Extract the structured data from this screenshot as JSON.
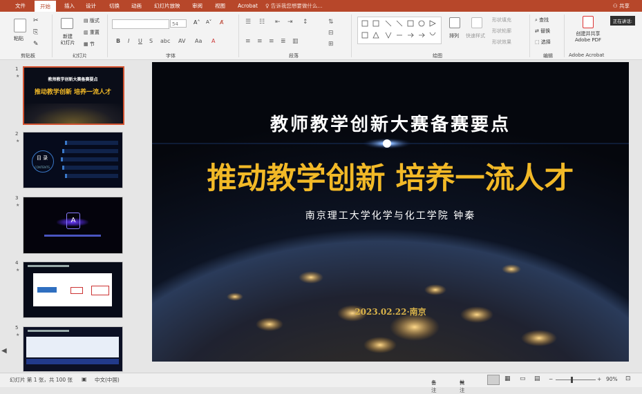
{
  "menu": {
    "tabs": [
      "文件",
      "开始",
      "插入",
      "设计",
      "切换",
      "动画",
      "幻灯片放映",
      "审阅",
      "视图",
      "Acrobat"
    ],
    "active_tab": "开始",
    "tell_me": "告诉我您想要做什么...",
    "share": "共享"
  },
  "ribbon": {
    "paste": "粘贴",
    "new_slide": "新建\n幻灯片",
    "layout": "版式",
    "reset": "重置",
    "section": "节",
    "font_size": "54",
    "arrange": "排列",
    "quick_styles": "快速样式",
    "shape_fill": "形状填充",
    "shape_outline": "形状轮廓",
    "shape_effect": "形状效果",
    "find": "查找",
    "replace": "替换",
    "select": "选择",
    "acrobat_button": "创建并共享\nAdobe PDF",
    "presenting": "正在讲话:",
    "groups": {
      "clipboard": "剪贴板",
      "slides": "幻灯片",
      "font": "字体",
      "paragraph": "段落",
      "drawing": "绘图",
      "editing": "编辑",
      "acrobat": "Adobe Acrobat"
    }
  },
  "thumbnails": [
    {
      "num": "1",
      "title": "推动教学创新 培养一流人才",
      "subtitle": "教师教学创新大赛备赛要点"
    },
    {
      "num": "2",
      "title": "目 录",
      "subtitle": "CONTENTS"
    },
    {
      "num": "3",
      "title": "A",
      "subtitle": ""
    },
    {
      "num": "4",
      "title": "",
      "subtitle": ""
    },
    {
      "num": "5",
      "title": "",
      "subtitle": ""
    }
  ],
  "slide": {
    "supertitle": "教师教学创新大赛备赛要点",
    "title": "推动教学创新 培养一流人才",
    "author": "南京理工大学化学与化工学院  钟秦",
    "date": "2023.02.22·南京"
  },
  "status": {
    "slide_info": "幻灯片 第 1 张，共 100 张",
    "language": "中文(中国)",
    "notes": "备注",
    "comments": "批注",
    "zoom": "90%"
  }
}
